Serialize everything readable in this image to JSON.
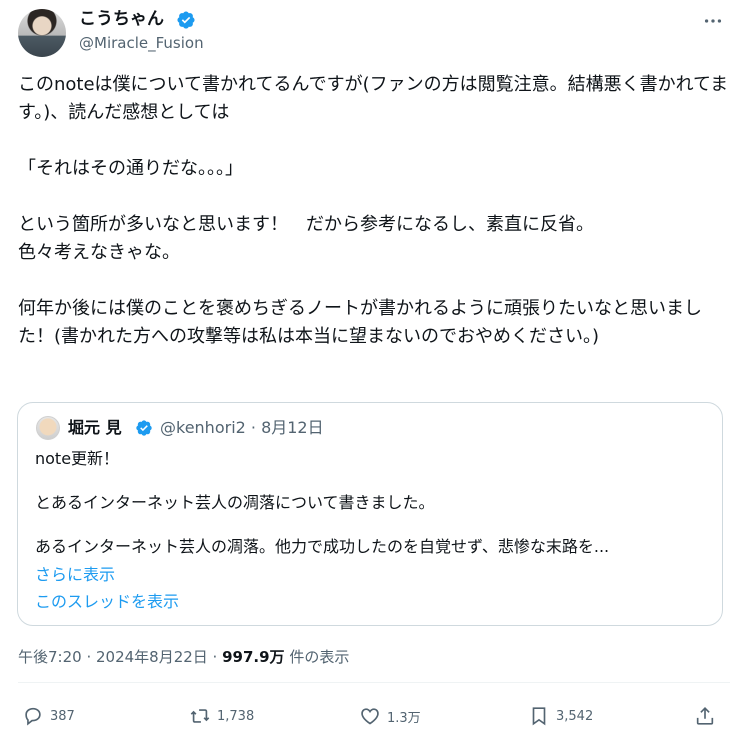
{
  "author": {
    "display_name": "こうちゃん",
    "handle": "@Miracle_Fusion"
  },
  "tweet": {
    "text": "このnoteは僕について書かれてるんですが(ファンの方は閲覧注意。結構悪く書かれてます。)、読んだ感想としては\n\n「それはその通りだな。。。」\n\nという箇所が多いなと思います！　だから参考になるし、素直に反省。\n色々考えなきゃな。\n\n何年か後には僕のことを褒めちぎるノートが書かれるように頑張りたいなと思いました！(書かれた方への攻撃等は私は本当に望まないのでおやめください。)"
  },
  "quote": {
    "display_name": "堀元 見",
    "handle_date": "@kenhori2 · 8月12日",
    "text": "note更新！\n\nとあるインターネット芸人の凋落について書きました。\n\nあるインターネット芸人の凋落。他力で成功したのを自覚せず、悲惨な末路を...",
    "show_more": "さらに表示",
    "show_thread": "このスレッドを表示"
  },
  "meta": {
    "time_date": "午後7:20 · 2024年8月22日 · ",
    "views_count": "997.9万",
    "views_label": " 件の表示"
  },
  "actions": {
    "replies": "387",
    "retweets": "1,738",
    "likes": "1.3万",
    "bookmarks": "3,542"
  },
  "colors": {
    "accent": "#1d9bf0",
    "secondary_text": "#536471",
    "border": "#cfd9de"
  },
  "icons": [
    "verified-badge-icon",
    "more-icon",
    "reply-icon",
    "retweet-icon",
    "like-icon",
    "bookmark-icon",
    "share-icon"
  ]
}
